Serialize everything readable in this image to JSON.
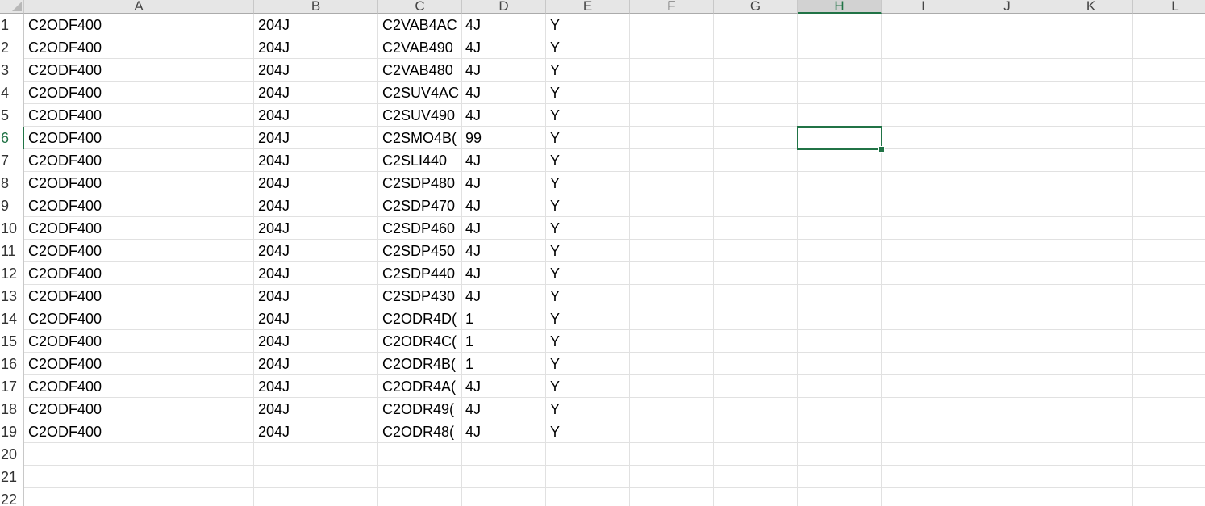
{
  "columns": [
    "A",
    "B",
    "C",
    "D",
    "E",
    "F",
    "G",
    "H",
    "I",
    "J",
    "K",
    "L"
  ],
  "active_column": "H",
  "active_row": "6",
  "row_numbers": [
    "1",
    "2",
    "3",
    "4",
    "5",
    "6",
    "7",
    "8",
    "9",
    "10",
    "11",
    "12",
    "13",
    "14",
    "15",
    "16",
    "17",
    "18",
    "19",
    "20",
    "21",
    "22"
  ],
  "rows": [
    {
      "a": "C2ODF400",
      "b": "204J",
      "c": "C2VAB4AC",
      "d": "4J",
      "e": "Y"
    },
    {
      "a": "C2ODF400",
      "b": "204J",
      "c": "C2VAB490",
      "d": "4J",
      "e": "Y"
    },
    {
      "a": "C2ODF400",
      "b": "204J",
      "c": "C2VAB480",
      "d": "4J",
      "e": "Y"
    },
    {
      "a": "C2ODF400",
      "b": "204J",
      "c": "C2SUV4AC",
      "d": "4J",
      "e": "Y"
    },
    {
      "a": "C2ODF400",
      "b": "204J",
      "c": "C2SUV490",
      "d": "4J",
      "e": "Y"
    },
    {
      "a": "C2ODF400",
      "b": "204J",
      "c": "C2SMO4B(",
      "d": "99",
      "e": "Y"
    },
    {
      "a": "C2ODF400",
      "b": "204J",
      "c": "C2SLI440",
      "d": "4J",
      "e": "Y"
    },
    {
      "a": "C2ODF400",
      "b": "204J",
      "c": "C2SDP480",
      "d": "4J",
      "e": "Y"
    },
    {
      "a": "C2ODF400",
      "b": "204J",
      "c": "C2SDP470",
      "d": "4J",
      "e": "Y"
    },
    {
      "a": "C2ODF400",
      "b": "204J",
      "c": "C2SDP460",
      "d": "4J",
      "e": "Y"
    },
    {
      "a": "C2ODF400",
      "b": "204J",
      "c": "C2SDP450",
      "d": "4J",
      "e": "Y"
    },
    {
      "a": "C2ODF400",
      "b": "204J",
      "c": "C2SDP440",
      "d": "4J",
      "e": "Y"
    },
    {
      "a": "C2ODF400",
      "b": "204J",
      "c": "C2SDP430",
      "d": "4J",
      "e": "Y"
    },
    {
      "a": "C2ODF400",
      "b": "204J",
      "c": "C2ODR4D(",
      "d": "1",
      "e": "Y"
    },
    {
      "a": "C2ODF400",
      "b": "204J",
      "c": "C2ODR4C(",
      "d": "1",
      "e": "Y"
    },
    {
      "a": "C2ODF400",
      "b": "204J",
      "c": "C2ODR4B(",
      "d": "1",
      "e": "Y"
    },
    {
      "a": "C2ODF400",
      "b": "204J",
      "c": "C2ODR4A(",
      "d": "4J",
      "e": "Y"
    },
    {
      "a": "C2ODF400",
      "b": "204J",
      "c": "C2ODR49(",
      "d": "4J",
      "e": "Y"
    },
    {
      "a": "C2ODF400",
      "b": "204J",
      "c": "C2ODR48(",
      "d": "4J",
      "e": "Y"
    }
  ],
  "colors": {
    "accent": "#217346",
    "header_bg": "#e6e6e6",
    "gridline": "#e1e1e1"
  }
}
